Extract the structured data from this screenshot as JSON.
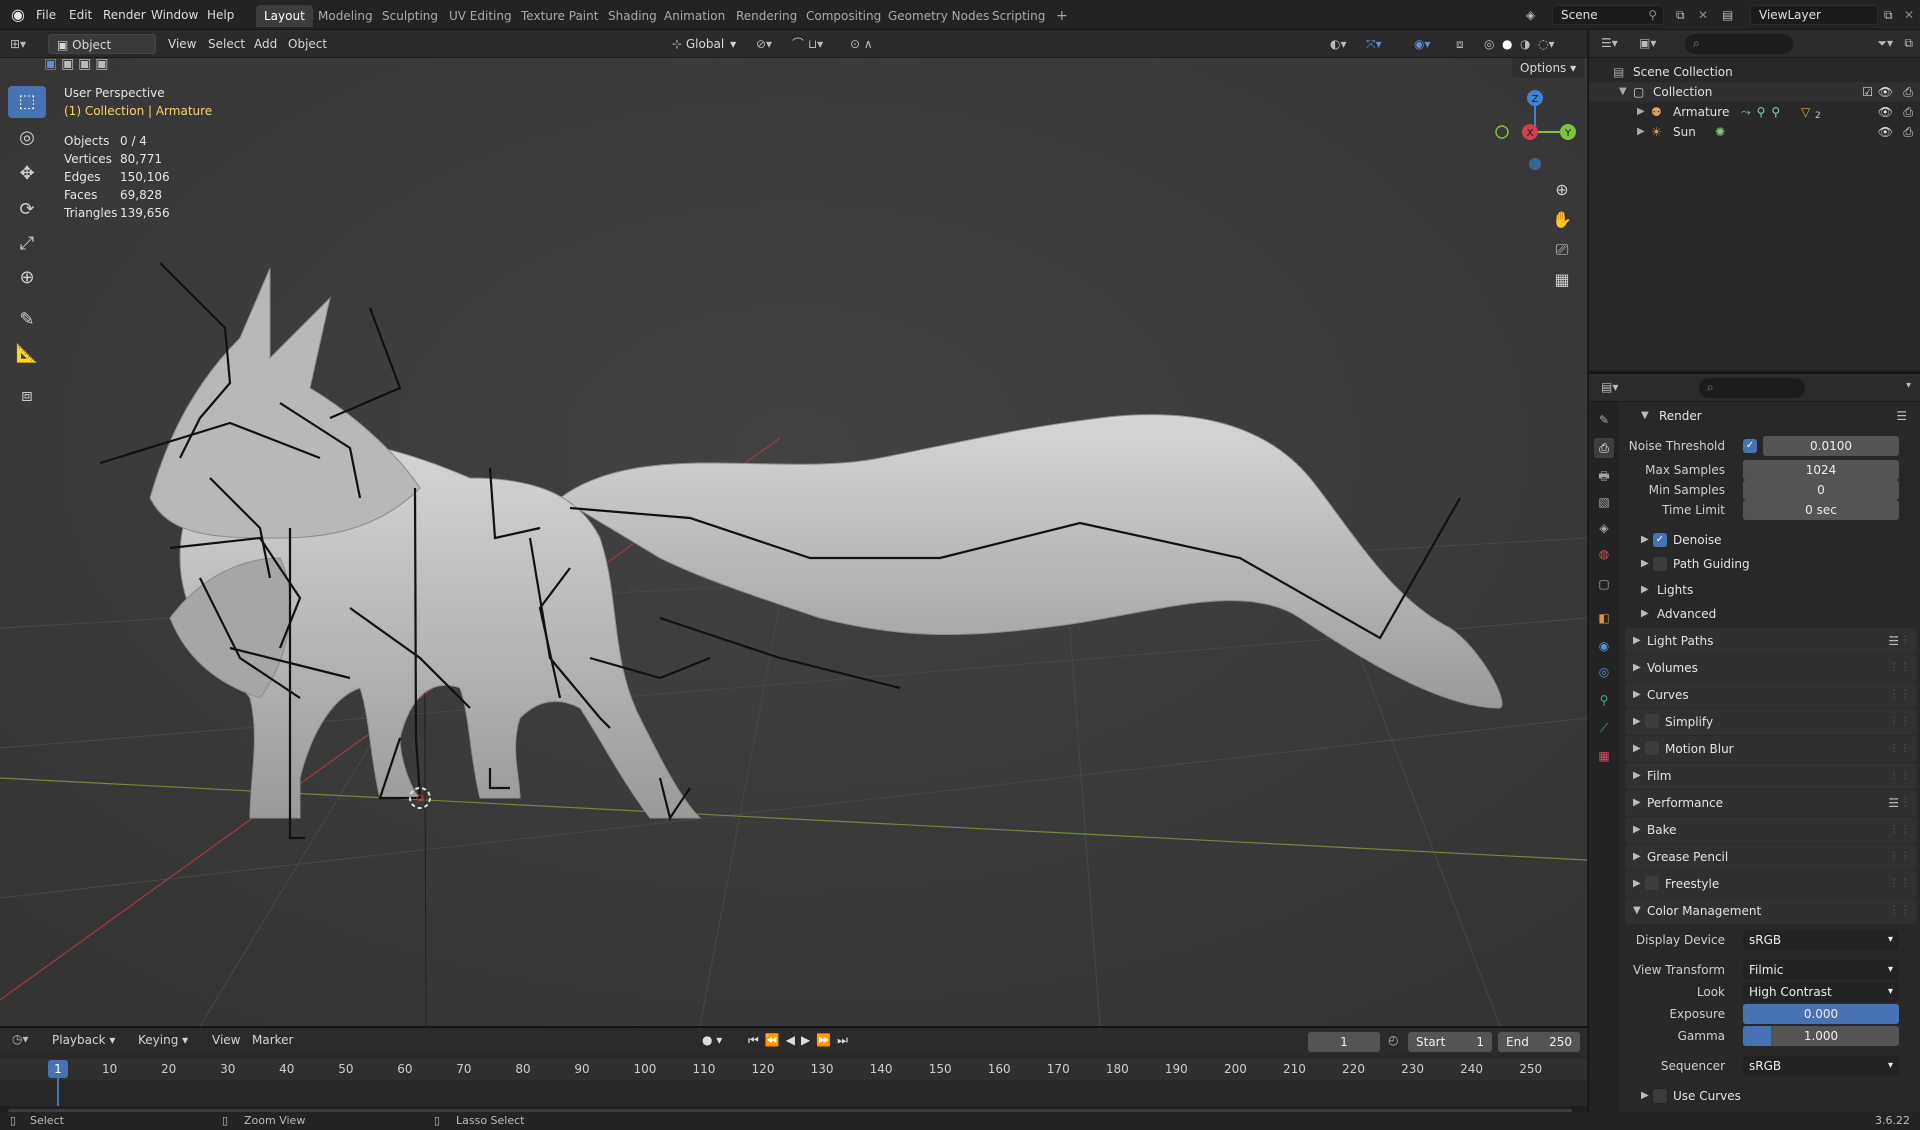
{
  "app": {
    "menus": [
      "File",
      "Edit",
      "Render",
      "Window",
      "Help"
    ],
    "workspaces": [
      "Layout",
      "Modeling",
      "Sculpting",
      "UV Editing",
      "Texture Paint",
      "Shading",
      "Animation",
      "Rendering",
      "Compositing",
      "Geometry Nodes",
      "Scripting"
    ],
    "add_workspace": "+",
    "scene": "Scene",
    "view_layer": "ViewLayer"
  },
  "viewport_header": {
    "mode": "Object Mode",
    "menus": [
      "View",
      "Select",
      "Add",
      "Object"
    ],
    "orientation": "Global",
    "options": "Options"
  },
  "viewport": {
    "perspective": "User Perspective",
    "context": "(1) Collection | Armature",
    "stats": [
      {
        "label": "Objects",
        "value": "0 / 4"
      },
      {
        "label": "Vertices",
        "value": "80,771"
      },
      {
        "label": "Edges",
        "value": "150,106"
      },
      {
        "label": "Faces",
        "value": "69,828"
      },
      {
        "label": "Triangles",
        "value": "139,656"
      }
    ],
    "gizmo": {
      "x": "X",
      "y": "Y",
      "z": "Z"
    }
  },
  "outliner": {
    "root": "Scene Collection",
    "collection": "Collection",
    "items": [
      {
        "name": "Armature",
        "badge": "2"
      },
      {
        "name": "Sun"
      }
    ]
  },
  "properties": {
    "render_panel": "Render",
    "noise_threshold": {
      "label": "Noise Threshold",
      "value": "0.0100"
    },
    "max_samples": {
      "label": "Max Samples",
      "value": "1024"
    },
    "min_samples": {
      "label": "Min Samples",
      "value": "0"
    },
    "time_limit": {
      "label": "Time Limit",
      "value": "0 sec"
    },
    "sub_panels": [
      "Denoise",
      "Path Guiding",
      "Lights",
      "Advanced"
    ],
    "panels": [
      "Light Paths",
      "Volumes",
      "Curves",
      "Simplify",
      "Motion Blur",
      "Film",
      "Performance",
      "Bake",
      "Grease Pencil",
      "Freestyle",
      "Color Management"
    ],
    "color_management": {
      "display_device": {
        "label": "Display Device",
        "value": "sRGB"
      },
      "view_transform": {
        "label": "View Transform",
        "value": "Filmic"
      },
      "look": {
        "label": "Look",
        "value": "High Contrast"
      },
      "exposure": {
        "label": "Exposure",
        "value": "0.000",
        "fill": 1.0
      },
      "gamma": {
        "label": "Gamma",
        "value": "1.000",
        "fill": 0.18
      },
      "sequencer": {
        "label": "Sequencer",
        "value": "sRGB"
      },
      "use_curves": "Use Curves"
    }
  },
  "timeline": {
    "menus": [
      "Playback",
      "Keying",
      "View",
      "Marker"
    ],
    "current_frame": "1",
    "start_label": "Start",
    "start": "1",
    "end_label": "End",
    "end": "250",
    "ticks": [
      "10",
      "20",
      "30",
      "40",
      "50",
      "60",
      "70",
      "80",
      "90",
      "100",
      "110",
      "120",
      "130",
      "140",
      "150",
      "160",
      "170",
      "180",
      "190",
      "200",
      "210",
      "220",
      "230",
      "240",
      "250"
    ],
    "cursor_label": "1"
  },
  "statusbar": {
    "select": "Select",
    "zoom": "Zoom View",
    "lasso": "Lasso Select",
    "version": "3.6.22"
  },
  "colors": {
    "accent": "#4772b3",
    "viewport_bg": "#3d3d3d",
    "context_text": "#ffcf6a",
    "x_axis": "#d04050",
    "y_axis": "#80c040",
    "z_axis": "#3c84d8"
  }
}
